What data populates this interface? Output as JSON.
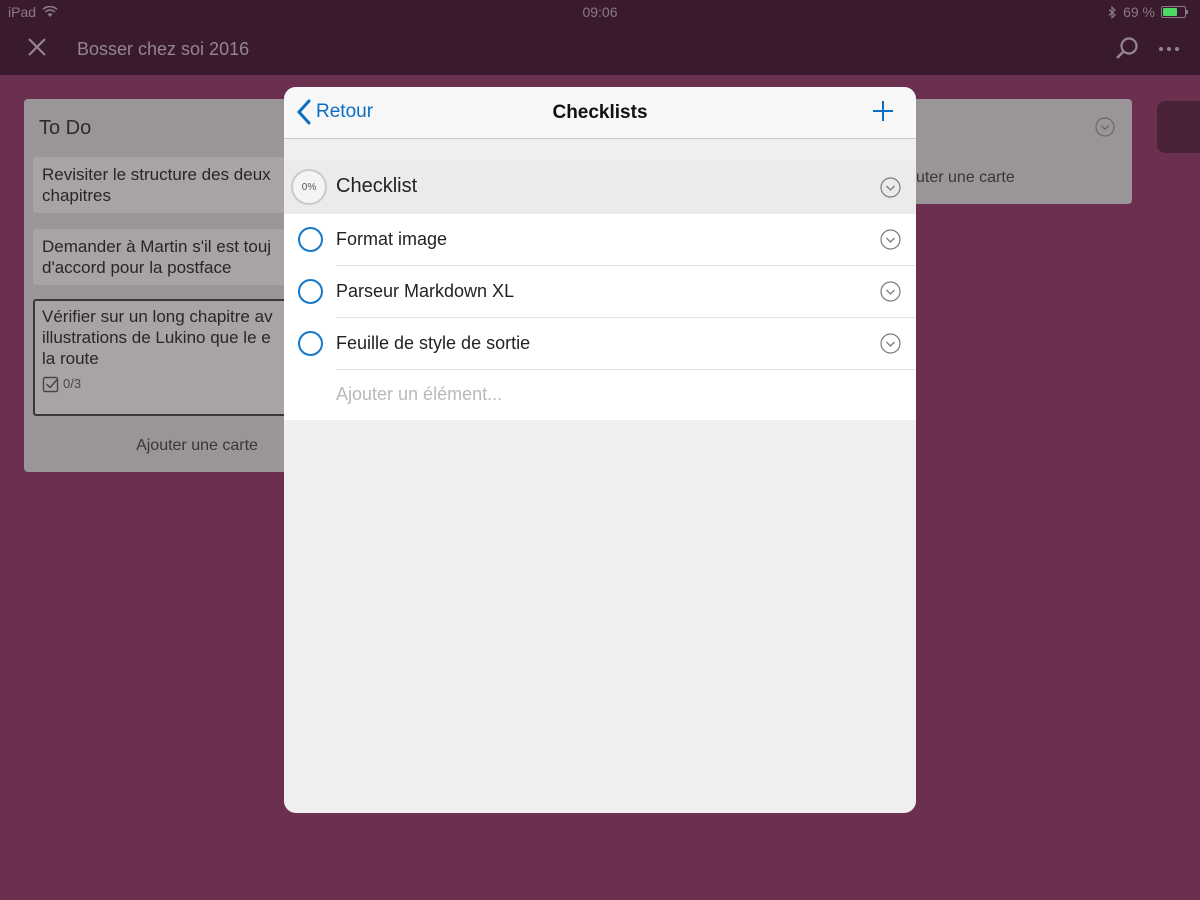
{
  "status_bar": {
    "device": "iPad",
    "time": "09:06",
    "battery_text": "69 %",
    "battery_level": 0.69,
    "battery_color": "#4cd964"
  },
  "nav": {
    "board_title": "Bosser chez soi 2016",
    "icons": [
      "close-icon",
      "search-icon",
      "more-icon"
    ]
  },
  "board": {
    "column_1": {
      "title": "To Do",
      "cards": [
        {
          "lines": [
            "Revisiter le structure des deux",
            "chapitres"
          ]
        },
        {
          "lines": [
            "Demander à Martin s'il est touj",
            "d'accord pour la postface"
          ]
        },
        {
          "lines": [
            "Vérifier sur un long chapitre av",
            "illustrations de Lukino que le e",
            "la route"
          ],
          "badge": "0/3"
        }
      ],
      "add_card": "Ajouter une carte"
    },
    "column_2": {
      "add_card": "uter une carte"
    }
  },
  "modal": {
    "back_label": "Retour",
    "title": "Checklists",
    "checklist": {
      "progress": "0%",
      "name": "Checklist",
      "items": [
        {
          "label": "Format image",
          "checked": false
        },
        {
          "label": "Parseur Markdown XL",
          "checked": false
        },
        {
          "label": "Feuille de style de sortie",
          "checked": false
        }
      ],
      "add_placeholder": "Ajouter un élément..."
    },
    "accent_color": "#1579c8"
  }
}
